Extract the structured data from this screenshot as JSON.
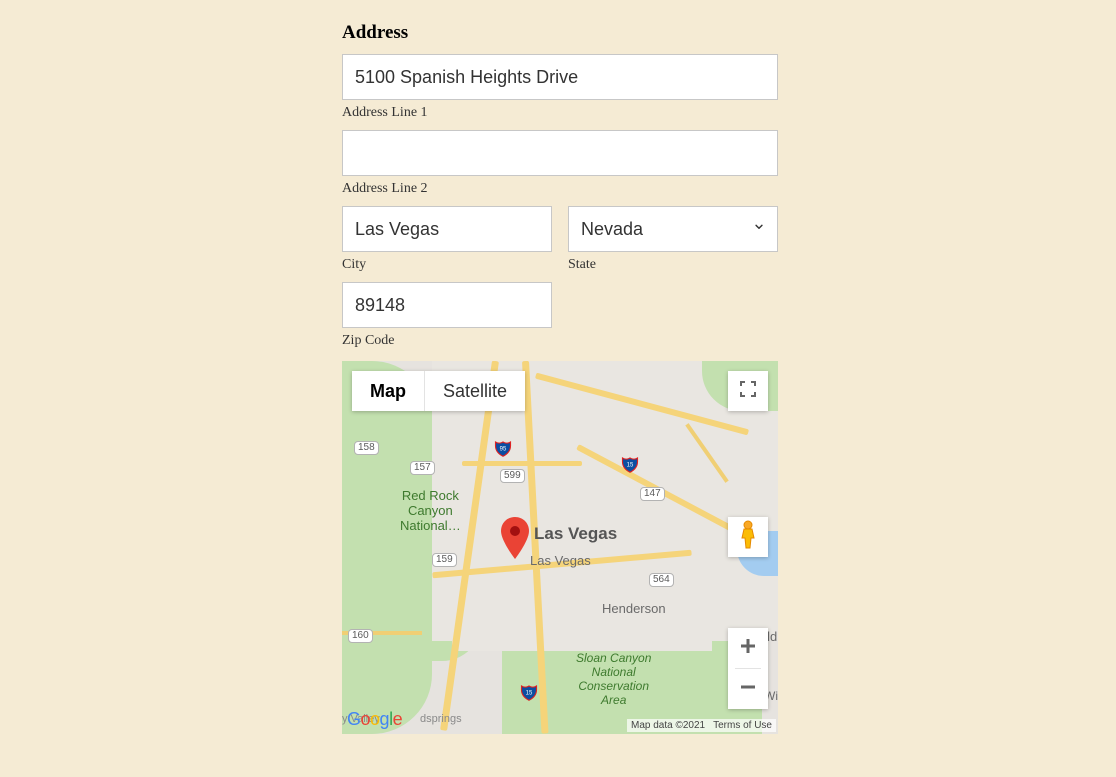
{
  "section_title": "Address",
  "fields": {
    "address1": {
      "label": "Address Line 1",
      "value": "5100 Spanish Heights Drive"
    },
    "address2": {
      "label": "Address Line 2",
      "value": ""
    },
    "city": {
      "label": "City",
      "value": "Las Vegas"
    },
    "state": {
      "label": "State",
      "value": "Nevada"
    },
    "zip": {
      "label": "Zip Code",
      "value": "89148"
    }
  },
  "map": {
    "type_tabs": {
      "map": "Map",
      "satellite": "Satellite"
    },
    "labels": {
      "las_vegas_bold": "Las Vegas",
      "las_vegas": "Las Vegas",
      "henderson": "Henderson",
      "boulder": "Bould",
      "wil": "Wil",
      "red_rock_l1": "Red Rock",
      "red_rock_l2": "Canyon",
      "red_rock_l3": "National…",
      "sloan_l1": "Sloan Canyon",
      "sloan_l2": "National",
      "sloan_l3": "Conservation",
      "sloan_l4": "Area",
      "valley_cut": "y Valley",
      "dsprings": "dsprings"
    },
    "shields": {
      "s158": "158",
      "s157": "157",
      "s599": "599",
      "s147": "147",
      "s159": "159",
      "s564": "564",
      "s160": "160"
    },
    "footer": {
      "data": "Map data ©2021",
      "terms": "Terms of Use"
    }
  }
}
